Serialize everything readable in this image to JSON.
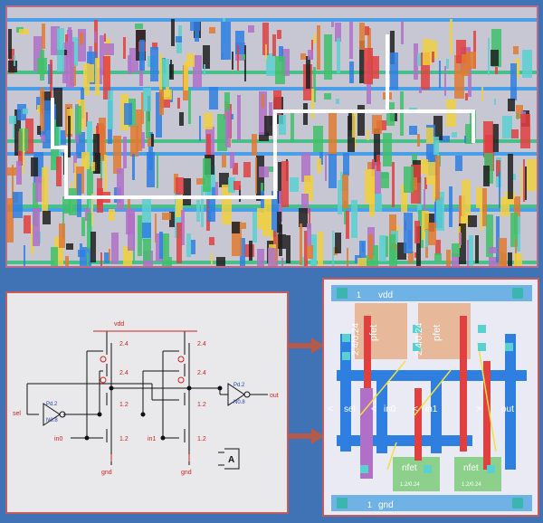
{
  "schematic": {
    "vdd": "vdd",
    "gnd_left": "gnd",
    "gnd_right": "gnd",
    "sel": "sel",
    "in0": "in0",
    "in1": "in1",
    "out": "out",
    "p_top_left": "2.4",
    "p_mid_left": "2.4",
    "p_top_right": "2.4",
    "p_mid_right": "2.4",
    "n_mid_left": "1.2",
    "n_bot_left": "1.2",
    "n_mid_right": "1.2",
    "n_bot_right": "1.2",
    "inv_sel_p": "Pd.2",
    "inv_sel_n": "N0.8",
    "inv_out_p": "Pd.2",
    "inv_out_n": "N0.8",
    "symbol": "A"
  },
  "cell": {
    "vdd": "vdd",
    "gnd": "gnd",
    "pfet_left": "pfet",
    "pfet_right": "pfet",
    "pfet_left_size": "2.4/0.24",
    "pfet_right_size": "2.4/0.24",
    "nfet_left": "nfet",
    "nfet_right": "nfet",
    "nfet_left_size": "1.2/0.24",
    "nfet_right_size": "1.2/0.24",
    "sel": "sel",
    "in0": "in0",
    "in1": "in1",
    "out": "out",
    "marker_vdd": "1",
    "marker_gnd": "1"
  },
  "colors": {
    "background": "#3f73b6",
    "arrow": "#b45a4a",
    "route": "#ffffff",
    "metal_blue": "#2f7fe0",
    "poly_red": "#e04040",
    "pfet_region": "#e8b89a",
    "nfet_region": "#8cd08c",
    "wire_yellow": "#f0e040"
  }
}
